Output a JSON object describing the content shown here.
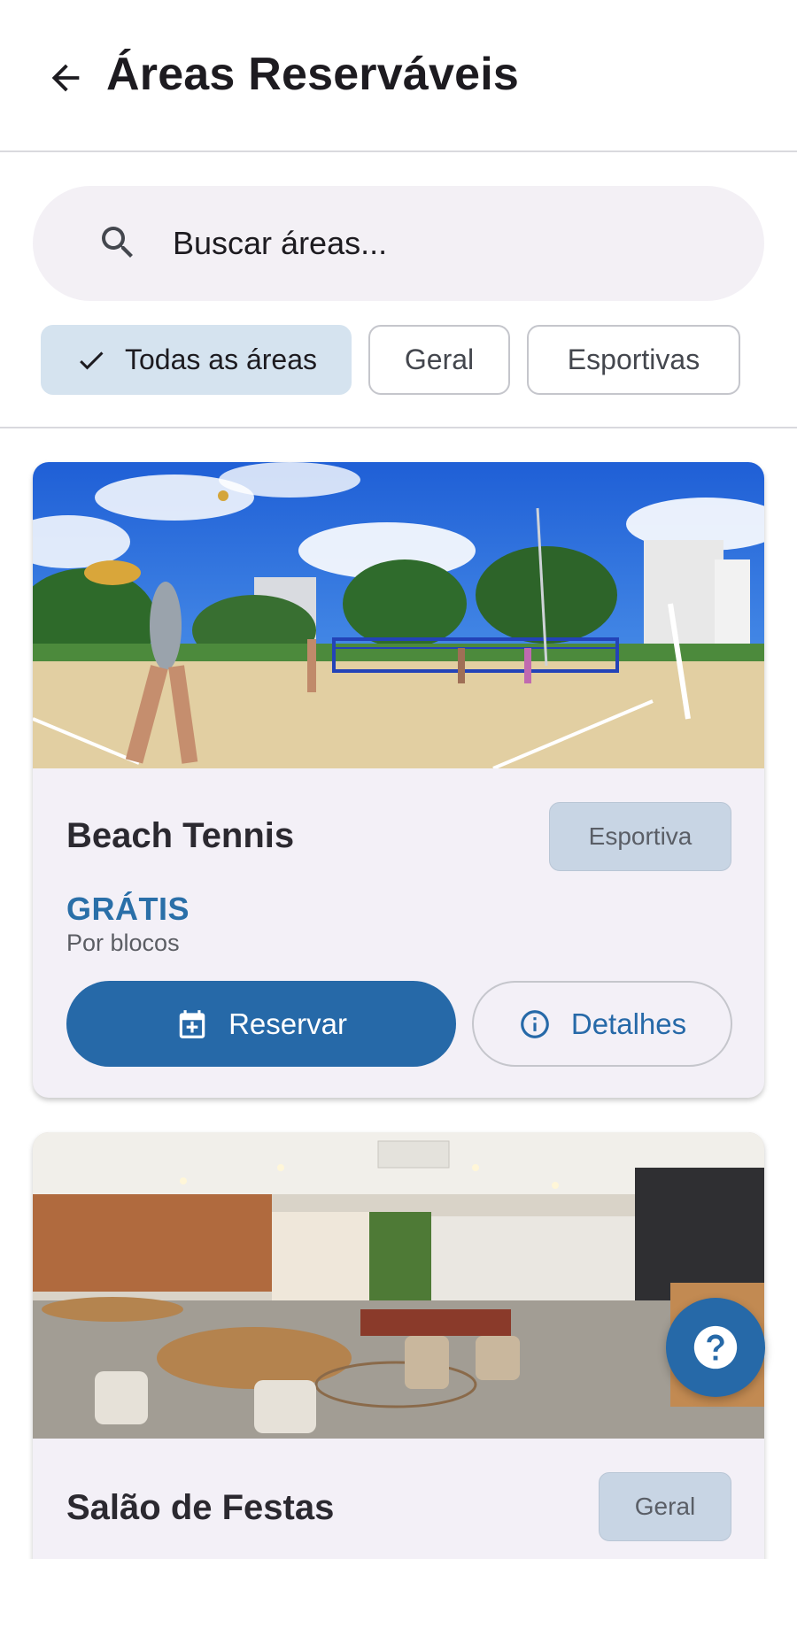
{
  "header": {
    "title": "Áreas Reserváveis",
    "back_icon": "arrow-left-icon"
  },
  "search": {
    "placeholder": "Buscar áreas...",
    "value": "",
    "icon": "search-icon"
  },
  "filters": [
    {
      "label": "Todas as áreas",
      "selected": true
    },
    {
      "label": "Geral",
      "selected": false
    },
    {
      "label": "Esportivas",
      "selected": false
    }
  ],
  "areas": [
    {
      "title": "Beach Tennis",
      "type": "Esportiva",
      "price": "GRÁTIS",
      "price_mode": "Por blocos",
      "reserve_label": "Reservar",
      "details_label": "Detalhes",
      "image": "beach-tennis-court-photo"
    },
    {
      "title": "Salão de Festas",
      "type": "Geral",
      "image": "party-hall-photo"
    }
  ],
  "fab": {
    "icon": "help-icon"
  },
  "colors": {
    "primary": "#2669a8",
    "chip_selected": "#d5e3ef",
    "card_bg": "#f3f0f7",
    "badge_bg": "#c8d5e4"
  }
}
